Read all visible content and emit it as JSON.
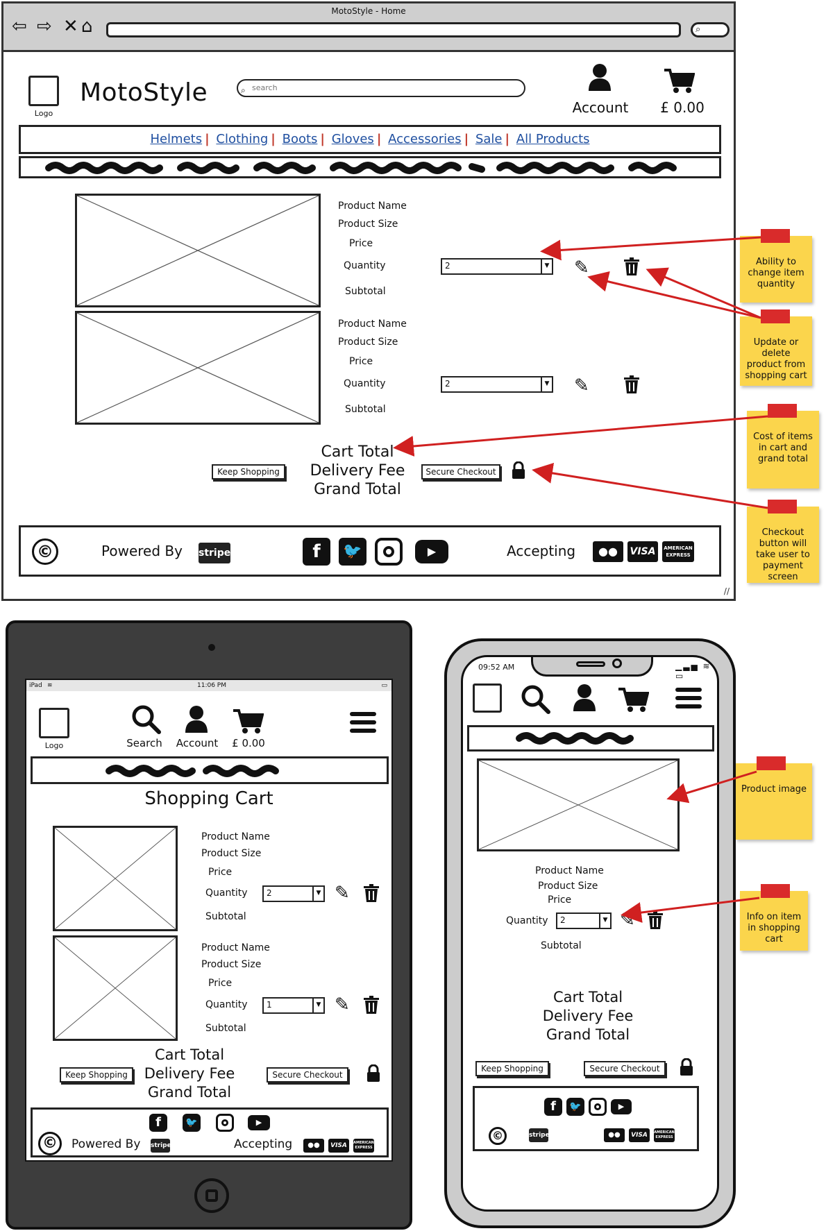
{
  "browser": {
    "window_title": "MotoStyle - Home",
    "nav_icons": [
      "back-arrow-icon",
      "forward-arrow-icon",
      "close-x-icon",
      "home-icon"
    ]
  },
  "desktop": {
    "logo_label": "Logo",
    "brand": "MotoStyle",
    "search_placeholder": "search",
    "account_label": "Account",
    "cart_label": "£ 0.00",
    "categories": [
      "Helmets",
      "Clothing",
      "Boots",
      "Gloves",
      "Accessories",
      "Sale",
      "All Products"
    ],
    "products": [
      {
        "name": "Product Name",
        "size": "Product Size",
        "price": "Price",
        "quantity_label": "Quantity",
        "quantity": "2",
        "subtotal": "Subtotal"
      },
      {
        "name": "Product Name",
        "size": "Product Size",
        "price": "Price",
        "quantity_label": "Quantity",
        "quantity": "2",
        "subtotal": "Subtotal"
      }
    ],
    "keep_shopping": "Keep Shopping",
    "secure_checkout": "Secure Checkout",
    "totals": [
      "Cart Total",
      "Delivery Fee",
      "Grand Total"
    ],
    "footer": {
      "copyright": "©",
      "powered_by": "Powered By",
      "stripe": "stripe",
      "accepting": "Accepting",
      "social_icons": [
        "facebook-icon",
        "twitter-icon",
        "instagram-icon",
        "youtube-icon"
      ],
      "payment_cards": [
        "mastercard",
        "VISA",
        "AMERICAN EXPRESS"
      ]
    }
  },
  "notes": [
    {
      "text": "Ability to change item quantity"
    },
    {
      "text": "Update or delete product from shopping cart"
    },
    {
      "text": "Cost of items in cart and grand total"
    },
    {
      "text": "Checkout button will take user to payment screen"
    },
    {
      "text": "Product image"
    },
    {
      "text": "Info on item in shopping cart"
    }
  ],
  "tablet": {
    "status_left": "iPad",
    "status_time": "11:06 PM",
    "logo_label": "Logo",
    "search_label": "Search",
    "account_label": "Account",
    "cart_label": "£ 0.00",
    "page_title": "Shopping Cart",
    "products": [
      {
        "name": "Product Name",
        "size": "Product Size",
        "price": "Price",
        "quantity_label": "Quantity",
        "quantity": "2",
        "subtotal": "Subtotal"
      },
      {
        "name": "Product Name",
        "size": "Product Size",
        "price": "Price",
        "quantity_label": "Quantity",
        "quantity": "1",
        "subtotal": "Subtotal"
      }
    ],
    "keep_shopping": "Keep Shopping",
    "secure_checkout": "Secure Checkout",
    "totals": [
      "Cart Total",
      "Delivery Fee",
      "Grand Total"
    ],
    "footer": {
      "powered_by": "Powered By",
      "stripe": "stripe",
      "accepting": "Accepting"
    }
  },
  "phone": {
    "status_time": "09:52 AM",
    "product": {
      "name": "Product Name",
      "size": "Product Size",
      "price": "Price",
      "quantity_label": "Quantity",
      "quantity": "2",
      "subtotal": "Subtotal"
    },
    "totals": [
      "Cart Total",
      "Delivery Fee",
      "Grand Total"
    ],
    "keep_shopping": "Keep Shopping",
    "secure_checkout": "Secure Checkout",
    "footer": {
      "stripe": "stripe"
    }
  },
  "colors": {
    "link": "#1f4fa0",
    "note": "#fbd54c",
    "tape": "#d92b2b",
    "arrow": "#d02020",
    "tablet_body": "#3d3d3d",
    "phone_body": "#cccccc"
  }
}
